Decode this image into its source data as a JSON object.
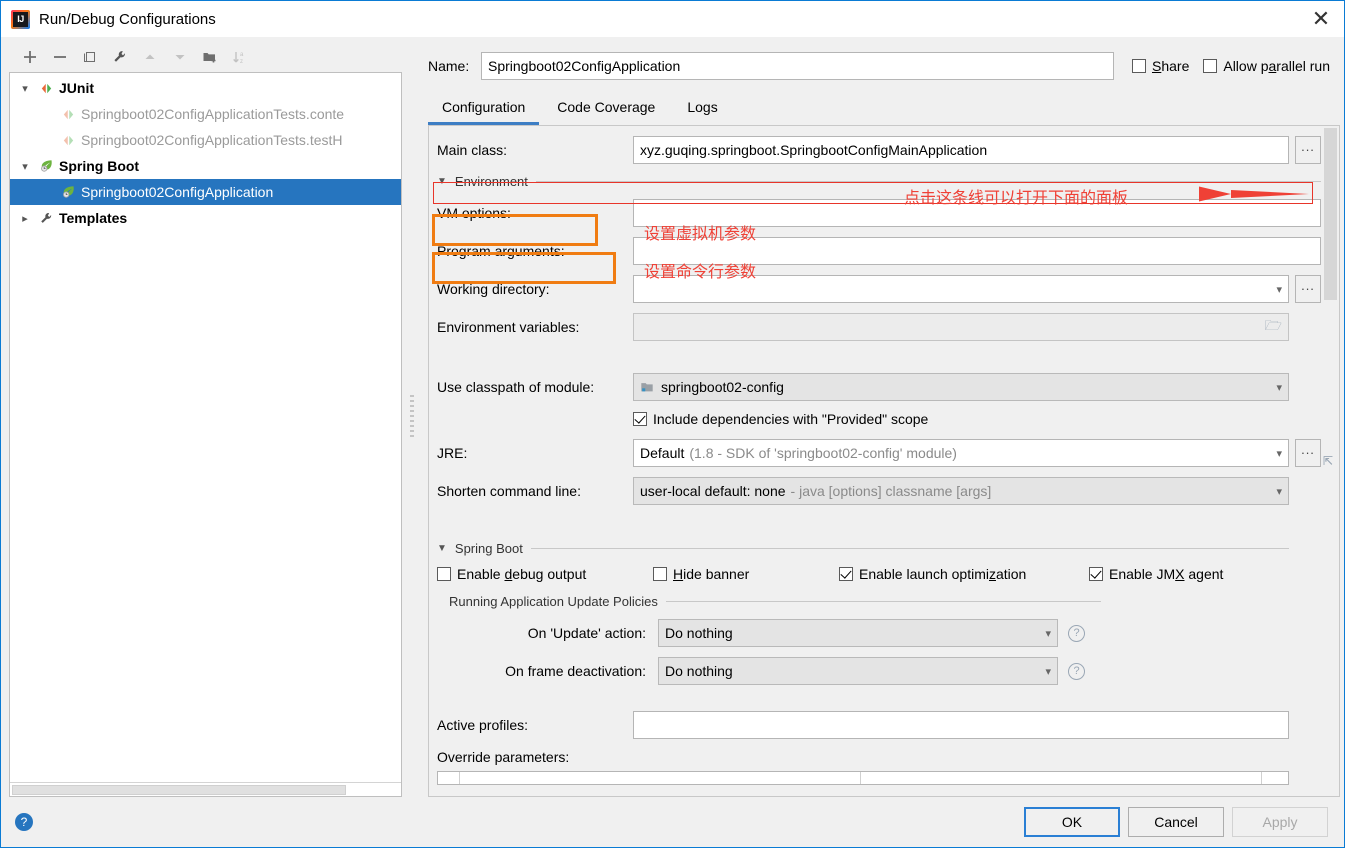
{
  "window": {
    "title": "Run/Debug Configurations",
    "app_icon": "intellij-idea-logo",
    "close_icon": "close-icon"
  },
  "toolbar": {
    "buttons": [
      {
        "name": "add",
        "icon": "plus-icon",
        "enabled": true
      },
      {
        "name": "remove",
        "icon": "minus-icon",
        "enabled": true
      },
      {
        "name": "copy",
        "icon": "copy-icon",
        "enabled": true
      },
      {
        "name": "edit-templates",
        "icon": "wrench-icon",
        "enabled": true
      },
      {
        "name": "move-up",
        "icon": "arrow-up-icon",
        "enabled": false
      },
      {
        "name": "move-down",
        "icon": "arrow-down-icon",
        "enabled": false
      },
      {
        "name": "new-folder",
        "icon": "folder-add-icon",
        "enabled": true
      },
      {
        "name": "sort-alphabetically",
        "icon": "sort-az-icon",
        "enabled": false
      }
    ]
  },
  "tree": {
    "nodes": [
      {
        "label": "JUnit",
        "icon": "junit-icon",
        "expanded": true,
        "level": 0,
        "bold": true,
        "selected": false
      },
      {
        "label": "Springboot02ConfigApplicationTests.conte",
        "icon": "junit-run-icon",
        "level": 1,
        "bold": false,
        "selected": false,
        "dim": true
      },
      {
        "label": "Springboot02ConfigApplicationTests.testH",
        "icon": "junit-run-icon",
        "level": 1,
        "bold": false,
        "selected": false,
        "dim": true
      },
      {
        "label": "Spring Boot",
        "icon": "spring-boot-icon",
        "expanded": true,
        "level": 0,
        "bold": true,
        "selected": false
      },
      {
        "label": "Springboot02ConfigApplication",
        "icon": "spring-boot-icon",
        "level": 1,
        "bold": false,
        "selected": true,
        "dim": false
      },
      {
        "label": "Templates",
        "icon": "wrench-icon",
        "expanded": false,
        "level": 0,
        "bold": true,
        "selected": false
      }
    ]
  },
  "form": {
    "name_label": "Name:",
    "name_value": "Springboot02ConfigApplication",
    "share_label": "Share",
    "share_checked": false,
    "allow_parallel_label": "Allow parallel run",
    "allow_parallel_checked": false
  },
  "tabs": [
    {
      "label": "Configuration",
      "active": true
    },
    {
      "label": "Code Coverage",
      "active": false
    },
    {
      "label": "Logs",
      "active": false
    }
  ],
  "configuration": {
    "main_class_label": "Main class:",
    "main_class_value": "xyz.guqing.springboot.SpringbootConfigMainApplication",
    "browse_label": "...",
    "environment_section": "Environment",
    "vm_options_label": "VM options:",
    "vm_options_value": "",
    "program_arguments_label": "Program arguments:",
    "program_arguments_value": "",
    "working_directory_label": "Working directory:",
    "working_directory_value": "",
    "environment_variables_label": "Environment variables:",
    "environment_variables_value": "",
    "use_classpath_label": "Use classpath of module:",
    "use_classpath_value": "springboot02-config",
    "include_deps_label": "Include dependencies with \"Provided\" scope",
    "include_deps_checked": true,
    "jre_label": "JRE:",
    "jre_value": "Default",
    "jre_hint": "(1.8 - SDK of 'springboot02-config' module)",
    "shorten_cmd_label": "Shorten command line:",
    "shorten_cmd_value": "user-local default: none",
    "shorten_cmd_hint": "- java [options] classname [args]",
    "spring_boot_section": "Spring Boot",
    "spring_checkboxes": [
      {
        "label": "Enable debug output",
        "underline_index": 7,
        "checked": false
      },
      {
        "label": "Hide banner",
        "underline_index": 0,
        "checked": false
      },
      {
        "label": "Enable launch optimization",
        "underline_index": 20,
        "checked": true
      },
      {
        "label": "Enable JMX agent",
        "underline_index": 10,
        "checked": true
      }
    ],
    "update_policies_section": "Running Application Update Policies",
    "on_update_label": "On 'Update' action:",
    "on_update_value": "Do nothing",
    "on_frame_label": "On frame deactivation:",
    "on_frame_value": "Do nothing",
    "help_icon": "question-mark-icon",
    "active_profiles_label": "Active profiles:",
    "active_profiles_value": "",
    "override_parameters_label": "Override parameters:"
  },
  "annotations": {
    "environment_hint": "点击这条线可以打开下面的面板",
    "vm_options_hint": "设置虚拟机参数",
    "program_arguments_hint": "设置命令行参数",
    "orange_color": "#f07c12",
    "red_color": "#ef4136"
  },
  "footer": {
    "help_icon": "question-mark-icon",
    "ok_label": "OK",
    "cancel_label": "Cancel",
    "apply_label": "Apply",
    "apply_enabled": false
  }
}
